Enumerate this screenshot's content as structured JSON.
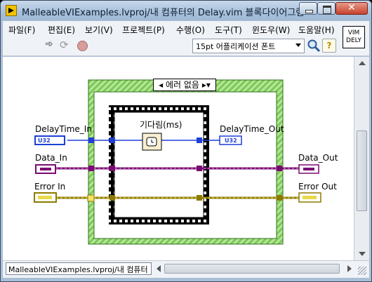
{
  "window": {
    "title": "MalleableVIExamples.lvproj/내 컴퓨터의 Delay.vim 블록다이어그램"
  },
  "menu": {
    "items": [
      "파일(F)",
      "편집(E)",
      "보기(V)",
      "프로젝트(P)",
      "수행(O)",
      "도구(T)",
      "윈도우(W)",
      "도움말(H)"
    ]
  },
  "toolbar": {
    "font_select_value": "15pt 어플리케이션 폰트",
    "vim_icon_line1": "VIM",
    "vim_icon_line2": "DELY"
  },
  "diagram": {
    "case_selector_value": "에러 없음",
    "wait_label": "기다림(ms)",
    "controls": {
      "delay_in_label": "DelayTime_In",
      "delay_in_type": "U32",
      "data_in_label": "Data_In",
      "error_in_label": "Error In"
    },
    "indicators": {
      "delay_out_label": "DelayTime_Out",
      "delay_out_type": "U32",
      "data_out_label": "Data_Out",
      "error_out_label": "Error Out"
    },
    "colors": {
      "u32_wire": "#1f3fd6",
      "variant_wire": "#7a0a72",
      "error_wire": "#b4a100",
      "case_border": "#3b8f29",
      "case_stripe": "#9ad77a"
    }
  },
  "status": {
    "path": "MalleableVIExamples.lvproj/내 컴퓨터"
  }
}
